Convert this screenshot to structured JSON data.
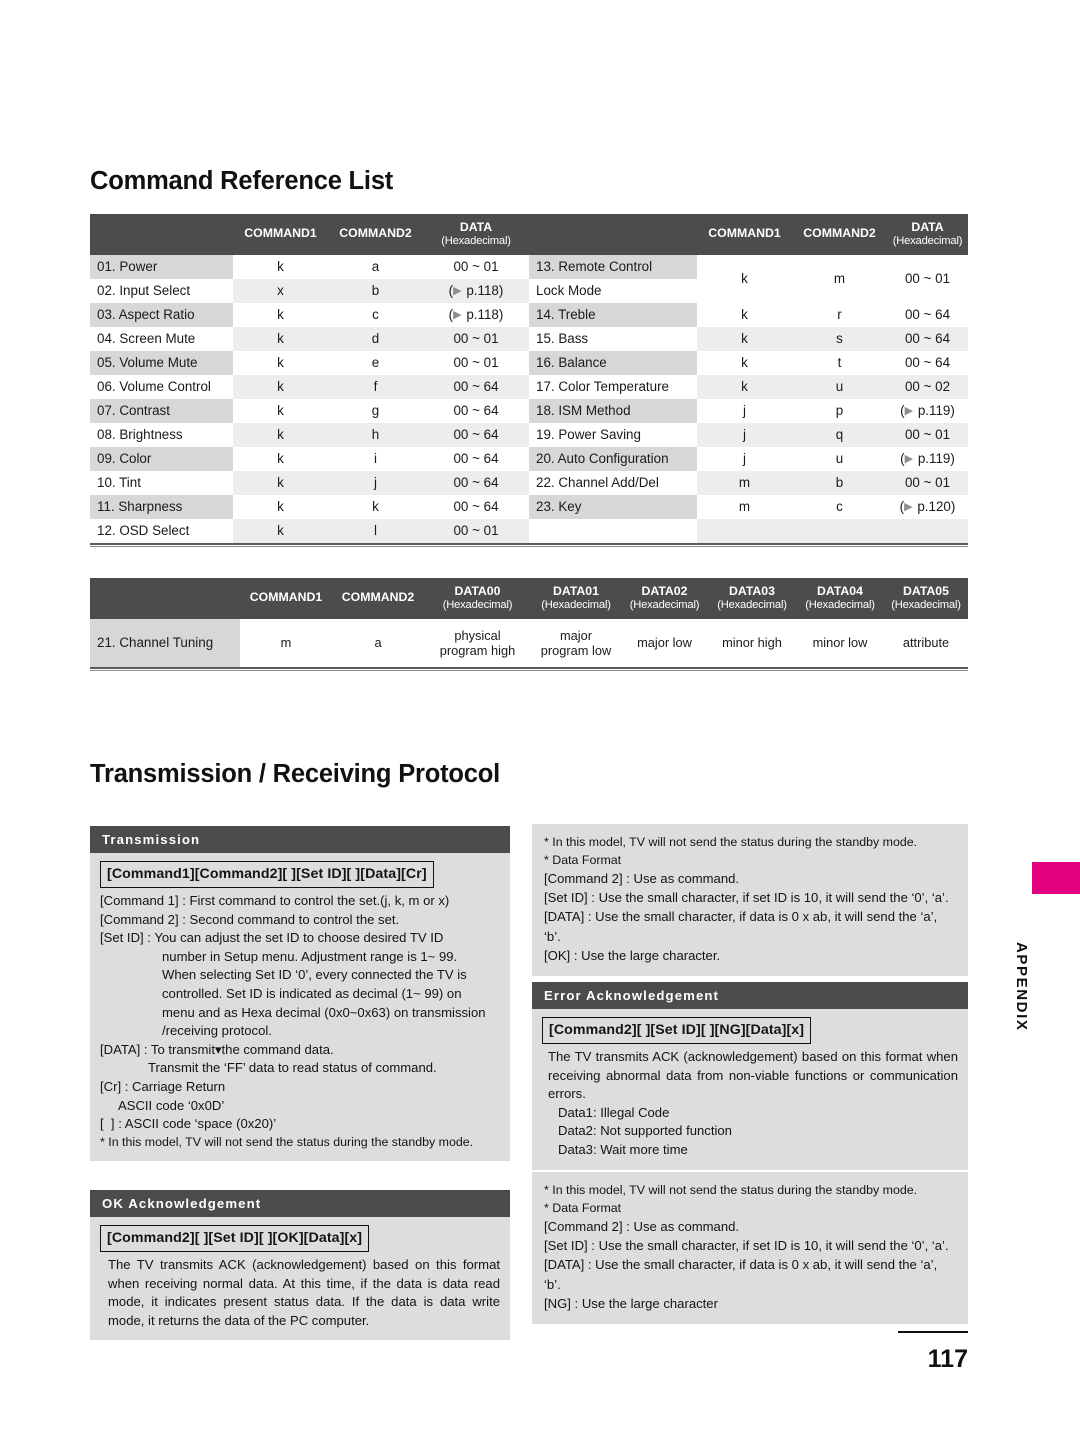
{
  "headings": {
    "command_reference": "Command Reference List",
    "transmission_protocol": "Transmission / Receiving  Protocol"
  },
  "command_table": {
    "headers": {
      "blank": "",
      "command1": "COMMAND1",
      "command2": "COMMAND2",
      "data": "DATA",
      "data_sub": "(Hexadecimal)"
    },
    "left_rows": [
      {
        "name": "01. Power",
        "command1": "k",
        "command2": "a",
        "data": "00 ~ 01"
      },
      {
        "name": "02. Input Select",
        "command1": "x",
        "command2": "b",
        "data": "( p.118)",
        "link": true,
        "page": "p.118"
      },
      {
        "name": "03. Aspect Ratio",
        "command1": "k",
        "command2": "c",
        "data": "( p.118)",
        "link": true,
        "page": "p.118"
      },
      {
        "name": "04. Screen Mute",
        "command1": "k",
        "command2": "d",
        "data": "00 ~ 01"
      },
      {
        "name": "05. Volume Mute",
        "command1": "k",
        "command2": "e",
        "data": "00 ~ 01"
      },
      {
        "name": "06. Volume Control",
        "command1": "k",
        "command2": "f",
        "data": "00 ~ 64"
      },
      {
        "name": "07. Contrast",
        "command1": "k",
        "command2": "g",
        "data": "00 ~ 64"
      },
      {
        "name": "08. Brightness",
        "command1": "k",
        "command2": "h",
        "data": "00 ~ 64"
      },
      {
        "name": "09. Color",
        "command1": "k",
        "command2": "i",
        "data": "00 ~ 64"
      },
      {
        "name": "10. Tint",
        "command1": "k",
        "command2": "j",
        "data": "00 ~ 64"
      },
      {
        "name": "11. Sharpness",
        "command1": "k",
        "command2": "k",
        "data": "00 ~ 64"
      },
      {
        "name": "12. OSD Select",
        "command1": "k",
        "command2": "l",
        "data": "00 ~ 01"
      }
    ],
    "right_rows": [
      {
        "name": "13. Remote Control",
        "name2": "Lock Mode",
        "command1": "k",
        "command2": "m",
        "data": "00 ~ 01",
        "spans": 2
      },
      {
        "name": "14. Treble",
        "command1": "k",
        "command2": "r",
        "data": "00 ~ 64"
      },
      {
        "name": "15. Bass",
        "command1": "k",
        "command2": "s",
        "data": "00 ~ 64"
      },
      {
        "name": "16. Balance",
        "command1": "k",
        "command2": "t",
        "data": "00 ~ 64"
      },
      {
        "name": "17. Color Temperature",
        "command1": "k",
        "command2": "u",
        "data": "00 ~ 02"
      },
      {
        "name": "18. ISM Method",
        "command1": "j",
        "command2": "p",
        "data": "( p.119)",
        "link": true,
        "page": "p.119"
      },
      {
        "name": "19. Power Saving",
        "command1": "j",
        "command2": "q",
        "data": "00 ~ 01"
      },
      {
        "name": "20. Auto Configuration",
        "command1": "j",
        "command2": "u",
        "data": "( p.119)",
        "link": true,
        "page": "p.119"
      },
      {
        "name": "22. Channel Add/Del",
        "command1": "m",
        "command2": "b",
        "data": "00 ~ 01"
      },
      {
        "name": "23. Key",
        "command1": "m",
        "command2": "c",
        "data": "( p.120)",
        "link": true,
        "page": "p.120"
      },
      {
        "name": "",
        "command1": "",
        "command2": "",
        "data": ""
      }
    ]
  },
  "tuning_table": {
    "headers": {
      "blank": "",
      "command1": "COMMAND1",
      "command2": "COMMAND2",
      "data00": "DATA00",
      "data01": "DATA01",
      "data02": "DATA02",
      "data03": "DATA03",
      "data04": "DATA04",
      "data05": "DATA05",
      "sub": "(Hexadecimal)"
    },
    "row": {
      "name": "21. Channel Tuning",
      "command1": "m",
      "command2": "a",
      "data00": "physical\nprogram high",
      "data01": "major\nprogram low",
      "data02": "major low",
      "data03": "minor high",
      "data04": "minor low",
      "data05": "attribute"
    }
  },
  "transmission_panel": {
    "title": "Transmission",
    "format": "[Command1][Command2][  ][Set ID][  ][Data][Cr]",
    "lines": [
      "[Command 1] : First command to control the set.(j, k, m or x)",
      "[Command 2] : Second command to control the set.",
      "[Set ID] : You can adjust the set ID to choose desired TV ID",
      "number in Setup menu. Adjustment range is 1~ 99.",
      "When selecting Set ID ‘0’, every connected the TV is",
      "controlled. Set ID is indicated as decimal (1~ 99) on",
      "menu and as Hexa decimal (0x0~0x63) on transmission",
      "/receiving protocol.",
      "[DATA] : To transmit▾the command data.",
      "Transmit the ‘FF’ data to read status of command.",
      "[Cr] : Carriage Return",
      "ASCII code ‘0x0D’",
      "[  ] : ASCII code ‘space (0x20)’",
      "* In this model, TV will not send the status during the standby mode."
    ]
  },
  "ok_panel": {
    "title": "OK Acknowledgement",
    "format": "[Command2][  ][Set ID][  ][OK][Data][x]",
    "body": "The TV transmits ACK (acknowledgement) based on this format when receiving normal data. At this time, if the data is data read mode, it indicates present status data. If the data is data write mode, it returns the data of the PC computer."
  },
  "right_note_top": {
    "lines": [
      "* In this model, TV will not send the status during the standby mode.",
      "* Data Format",
      "[Command 2] : Use as command.",
      "[Set ID] : Use the small character, if set ID is 10, it will send the ‘0’, ‘a’.",
      "[DATA] : Use the small character, if data is 0 x ab, it will send the ‘a’, ‘b’.",
      "[OK] : Use the large character."
    ]
  },
  "error_panel": {
    "title": "Error Acknowledgement",
    "format": "[Command2][  ][Set ID][  ][NG][Data][x]",
    "body": "The TV transmits ACK (acknowledgement) based on this format when receiving abnormal data from non-viable functions or communication errors.",
    "data_items": [
      "Data1: Illegal Code",
      "Data2: Not supported function",
      "Data3: Wait more time"
    ]
  },
  "right_note_bottom": {
    "lines": [
      "* In this model, TV will not send the status during the standby mode.",
      "* Data Format",
      "[Command 2] : Use as command.",
      "[Set ID] : Use the small character, if set ID is 10, it will send the ‘0’, ‘a’.",
      "[DATA] : Use the small character, if data is 0 x ab, it will send the ‘a’, ‘b’.",
      "[NG] : Use the large character"
    ]
  },
  "sidebar": {
    "label": "APPENDIX",
    "tab_color": "#e2007f"
  },
  "footer": {
    "page_number": "117"
  }
}
